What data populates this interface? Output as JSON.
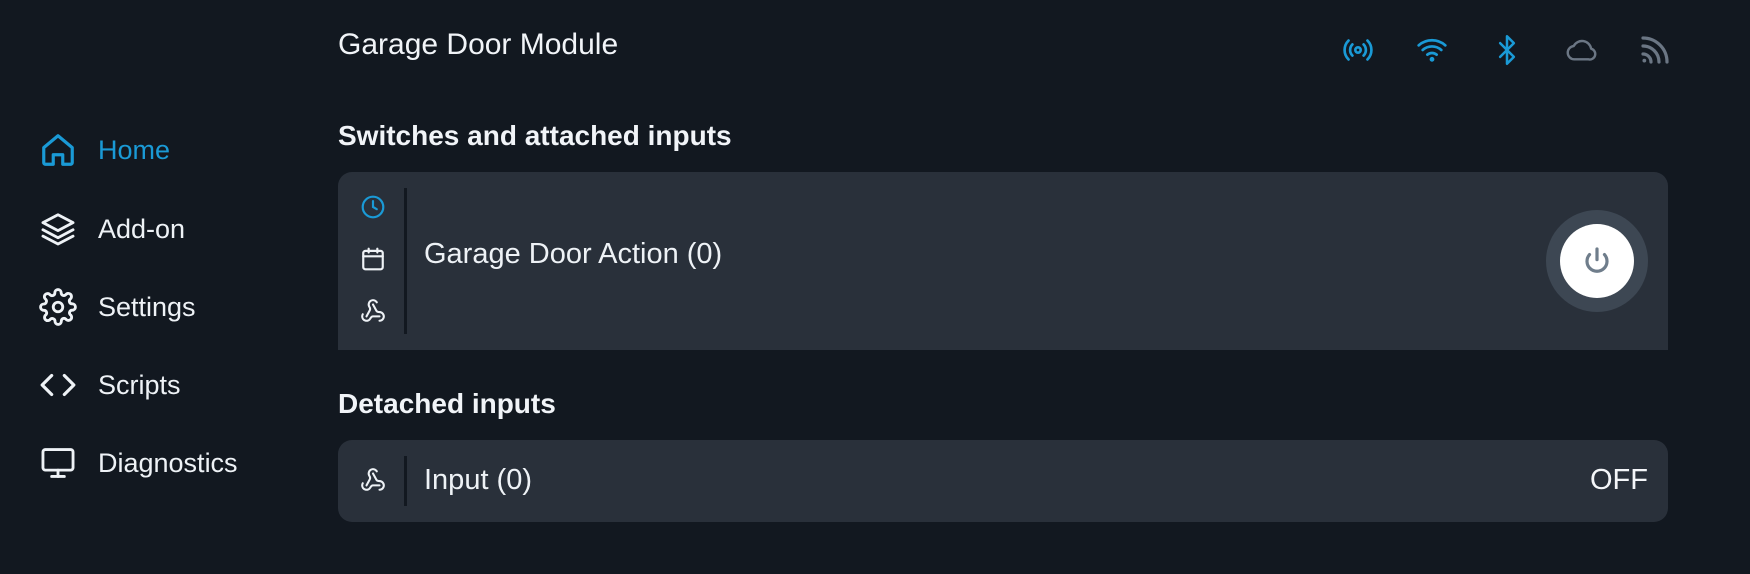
{
  "sidebar": {
    "items": [
      {
        "label": "Home",
        "icon": "home-icon",
        "active": true
      },
      {
        "label": "Add-on",
        "icon": "layers-icon",
        "active": false
      },
      {
        "label": "Settings",
        "icon": "gear-icon",
        "active": false
      },
      {
        "label": "Scripts",
        "icon": "code-icon",
        "active": false
      },
      {
        "label": "Diagnostics",
        "icon": "monitor-icon",
        "active": false
      }
    ]
  },
  "header": {
    "title": "Garage Door Module",
    "status_icons": [
      "broadcast-icon",
      "wifi-icon",
      "bluetooth-icon",
      "cloud-icon",
      "rss-icon"
    ]
  },
  "sections": {
    "switches": {
      "title": "Switches and attached inputs",
      "items": [
        {
          "name": "Garage Door Action (0)",
          "icons": [
            "clock-icon",
            "calendar-icon",
            "webhook-icon"
          ]
        }
      ]
    },
    "detached": {
      "title": "Detached inputs",
      "items": [
        {
          "name": "Input (0)",
          "state": "OFF",
          "icon": "webhook-icon"
        }
      ]
    }
  },
  "colors": {
    "background": "#121820",
    "card": "#29303a",
    "accent": "#1a9ad6",
    "muted_icon": "#6b7684"
  }
}
